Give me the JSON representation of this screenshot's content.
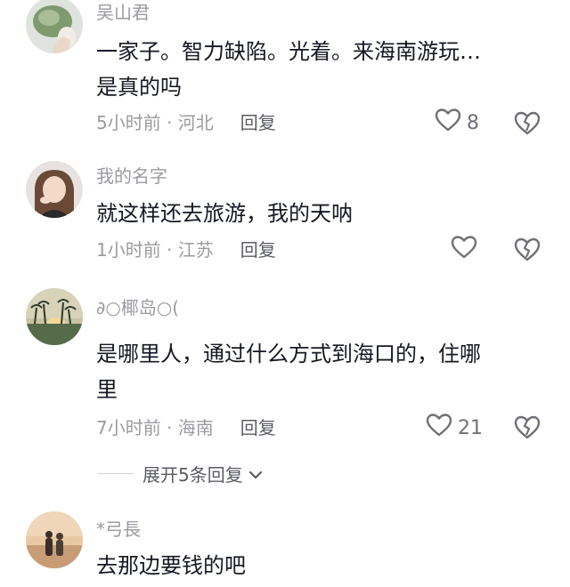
{
  "comments": [
    {
      "username": "吴山君",
      "text": "一家子。智力缺陷。光着。来海南游玩…\n是真的吗",
      "time": "5小时前 · 河北",
      "reply": "回复",
      "likes": "8"
    },
    {
      "username": "我的名字",
      "text": "就这样还去旅游，我的天呐",
      "time": "1小时前 · 江苏",
      "reply": "回复",
      "likes": ""
    },
    {
      "username": "椰岛",
      "username_decor_left": "∂○",
      "username_decor_right": "○(",
      "text": "是哪里人，通过什么方式到海口的，住哪\n里",
      "time": "7小时前 · 海南",
      "reply": "回复",
      "likes": "21"
    },
    {
      "username": "*弓長",
      "text": "去那边要钱的吧"
    }
  ],
  "expand_replies": "展开5条回复",
  "icons": {
    "like": "heart-outline-icon",
    "dislike": "broken-heart-icon",
    "expand": "chevron-down-icon"
  },
  "colors": {
    "text": "#161823",
    "secondary": "#9a9ba1",
    "icon": "#6f7078"
  }
}
